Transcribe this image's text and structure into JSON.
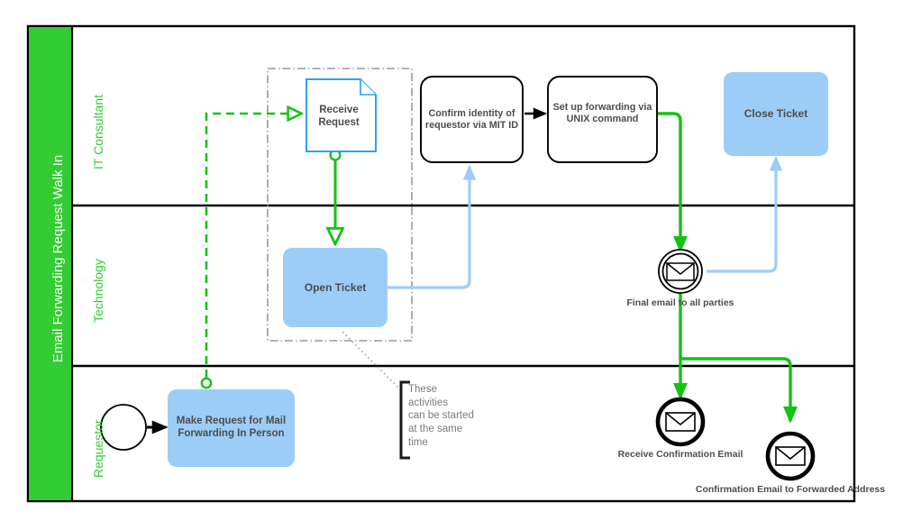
{
  "diagram": {
    "type": "bpmn-swimlane",
    "pool": {
      "label": "Email Forwarding Request\nWalk In",
      "header_color": "#33cc33",
      "header_text_color": "#ffffff",
      "border_color": "#000000"
    },
    "lanes": [
      {
        "id": "lane-it-consultant",
        "label": "IT Consultant",
        "label_color": "#33cc33"
      },
      {
        "id": "lane-technology",
        "label": "Technology",
        "label_color": "#33cc33"
      },
      {
        "id": "lane-requestor",
        "label": "Requestor",
        "label_color": "#33cc33"
      }
    ],
    "nodes": [
      {
        "id": "receive-request",
        "label": "Receive\nRequest",
        "shape": "document",
        "fill": "#ffffff",
        "stroke": "#29a3ef",
        "lane": "IT Consultant"
      },
      {
        "id": "confirm-identity",
        "label": "Confirm identity of\nrequestor via MIT ID",
        "shape": "rounded-rect",
        "fill": "#ffffff",
        "stroke": "#000000",
        "lane": "IT Consultant"
      },
      {
        "id": "set-up-forwarding",
        "label": "Set up forwarding via\nUNIX command",
        "shape": "rounded-rect",
        "fill": "#ffffff",
        "stroke": "#000000",
        "lane": "IT Consultant"
      },
      {
        "id": "close-ticket",
        "label": "Close Ticket",
        "shape": "rounded-rect",
        "fill": "#9ccdf7",
        "stroke": "none",
        "lane": "IT Consultant"
      },
      {
        "id": "open-ticket",
        "label": "Open Ticket",
        "shape": "rounded-rect",
        "fill": "#9ccdf7",
        "stroke": "none",
        "lane": "Technology"
      },
      {
        "id": "make-request",
        "label": "Make Request for Mail\nForwarding In Person",
        "shape": "rounded-rect",
        "fill": "#9ccdf7",
        "stroke": "none",
        "lane": "Requestor"
      }
    ],
    "events": [
      {
        "id": "start-event",
        "type": "start",
        "label": "",
        "lane": "Requestor"
      },
      {
        "id": "final-email-event",
        "type": "intermediate-message",
        "label": "Final email to all parties",
        "lane": "Technology"
      },
      {
        "id": "receive-confirmation-email",
        "type": "end-message",
        "label": "Receive Confirmation Email",
        "lane": "Requestor"
      },
      {
        "id": "confirmation-email-forwarded",
        "type": "end-message",
        "label": "Confirmation Email to Forwarded Address",
        "lane": "Requestor"
      }
    ],
    "annotation": {
      "id": "parallel-activities-note",
      "text": "These\nactivities\ncan be started\nat the same\ntime",
      "color": "#7a7a7a"
    },
    "group": {
      "id": "parallel-group",
      "style": "dash-dot",
      "stroke": "#999999"
    },
    "colors": {
      "green_flow": "#12c312",
      "blue_flow": "#9ccdf7",
      "black_flow": "#000000",
      "node_blue_fill": "#9ccdf7",
      "doc_stroke": "#29a3ef",
      "lane_text": "#33cc33",
      "pool_fill": "#33cc33",
      "label_text": "#4d4d4d",
      "annotation_text": "#7a7a7a"
    }
  }
}
